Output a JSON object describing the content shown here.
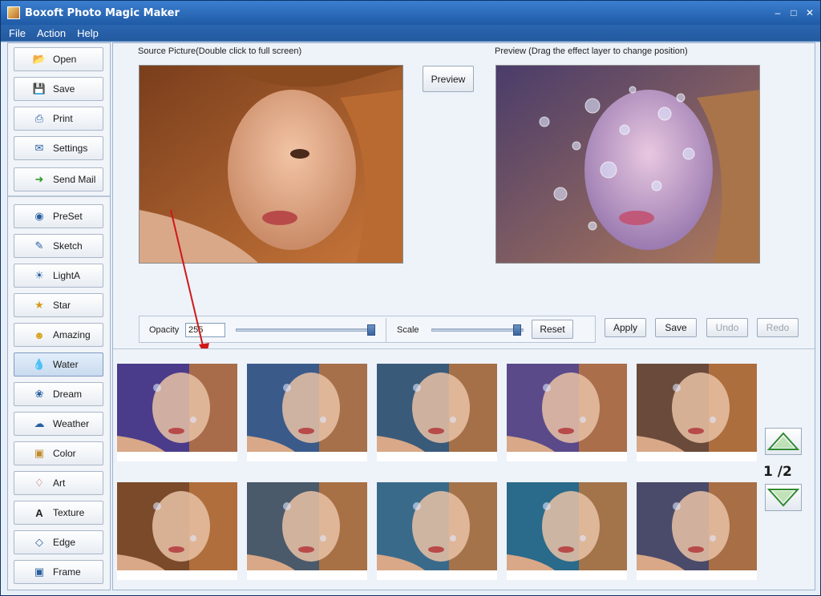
{
  "window": {
    "title": "Boxoft Photo Magic Maker"
  },
  "menu": [
    "File",
    "Action",
    "Help"
  ],
  "sidebar": {
    "file_buttons": [
      {
        "label": "Open",
        "icon": "folder-open-icon"
      },
      {
        "label": "Save",
        "icon": "floppy-disk-icon"
      },
      {
        "label": "Print",
        "icon": "printer-icon"
      },
      {
        "label": "Settings",
        "icon": "settings-icon"
      },
      {
        "label": "Send Mail",
        "icon": "mail-send-icon"
      }
    ],
    "effect_buttons": [
      {
        "label": "PreSet",
        "icon": "preset-icon"
      },
      {
        "label": "Sketch",
        "icon": "sketch-icon"
      },
      {
        "label": "LightA",
        "icon": "light-icon"
      },
      {
        "label": "Star",
        "icon": "star-icon"
      },
      {
        "label": "Amazing",
        "icon": "amazing-icon"
      },
      {
        "label": "Water",
        "icon": "water-drop-icon"
      },
      {
        "label": "Dream",
        "icon": "dream-icon"
      },
      {
        "label": "Weather",
        "icon": "weather-icon"
      },
      {
        "label": "Color",
        "icon": "color-icon"
      },
      {
        "label": "Art",
        "icon": "art-icon"
      },
      {
        "label": "Texture",
        "icon": "texture-icon"
      },
      {
        "label": "Edge",
        "icon": "edge-icon"
      },
      {
        "label": "Frame",
        "icon": "frame-icon"
      }
    ],
    "active_effect": "Water"
  },
  "main": {
    "source_label": "Source Picture(Double click to full screen)",
    "preview_label": "Preview (Drag the effect layer to change position)",
    "preview_button": "Preview",
    "opacity_label": "Opacity",
    "opacity_value": "255",
    "scale_label": "Scale",
    "reset_button": "Reset",
    "apply_button": "Apply",
    "save_button": "Save",
    "undo_button": "Undo",
    "redo_button": "Redo"
  },
  "gallery": {
    "page_indicator": "1 /2",
    "thumb_count": 10
  },
  "colors": {
    "accent": "#2a66b0",
    "page_arrow": "#3a9a3a"
  }
}
